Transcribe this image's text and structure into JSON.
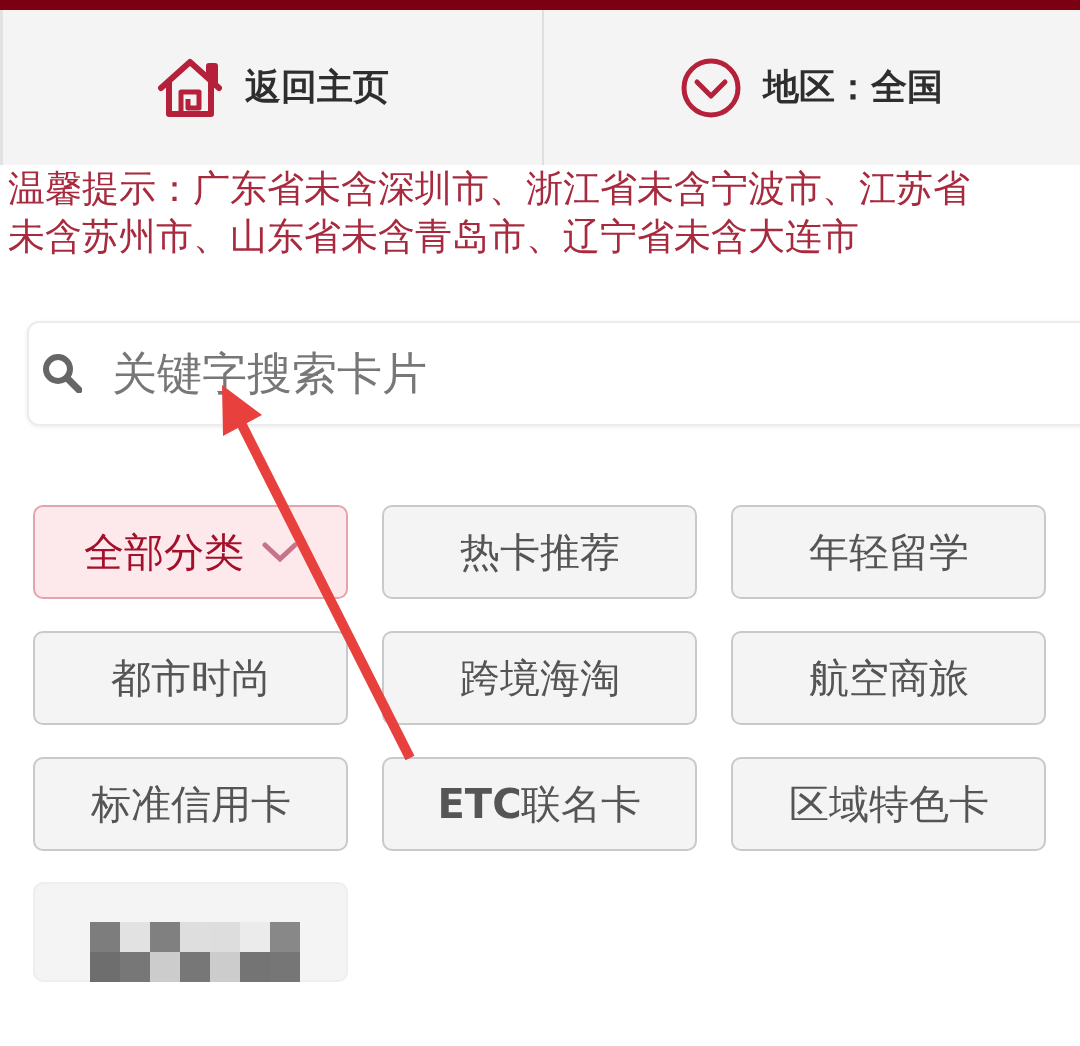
{
  "top_nav": {
    "items": [
      {
        "kind": "home",
        "label": "返回主页"
      },
      {
        "kind": "region",
        "label": "地区：全国"
      }
    ]
  },
  "notice": "温馨提示：广东省未含深圳市、浙江省未含宁波市、江苏省未含苏州市、山东省未含青岛市、辽宁省未含大连市",
  "search": {
    "placeholder": "关键字搜索卡片"
  },
  "categories": [
    {
      "kind": "option",
      "label": "全部分类",
      "selected": true
    },
    {
      "kind": "option",
      "label": "热卡推荐",
      "selected": false
    },
    {
      "kind": "option",
      "label": "年轻留学",
      "selected": false
    },
    {
      "kind": "option",
      "label": "都市时尚",
      "selected": false
    },
    {
      "kind": "option",
      "label": "跨境海淘",
      "selected": false
    },
    {
      "kind": "option",
      "label": "航空商旅",
      "selected": false
    },
    {
      "kind": "option",
      "label": "标准信用卡",
      "selected": false
    },
    {
      "kind": "option",
      "label": "**ETC**联名卡",
      "selected": false
    },
    {
      "kind": "option",
      "label": "区域特色卡",
      "selected": false
    },
    {
      "kind": "redacted",
      "selected": false
    }
  ],
  "annotations": [
    {
      "kind": "arrow"
    }
  ]
}
